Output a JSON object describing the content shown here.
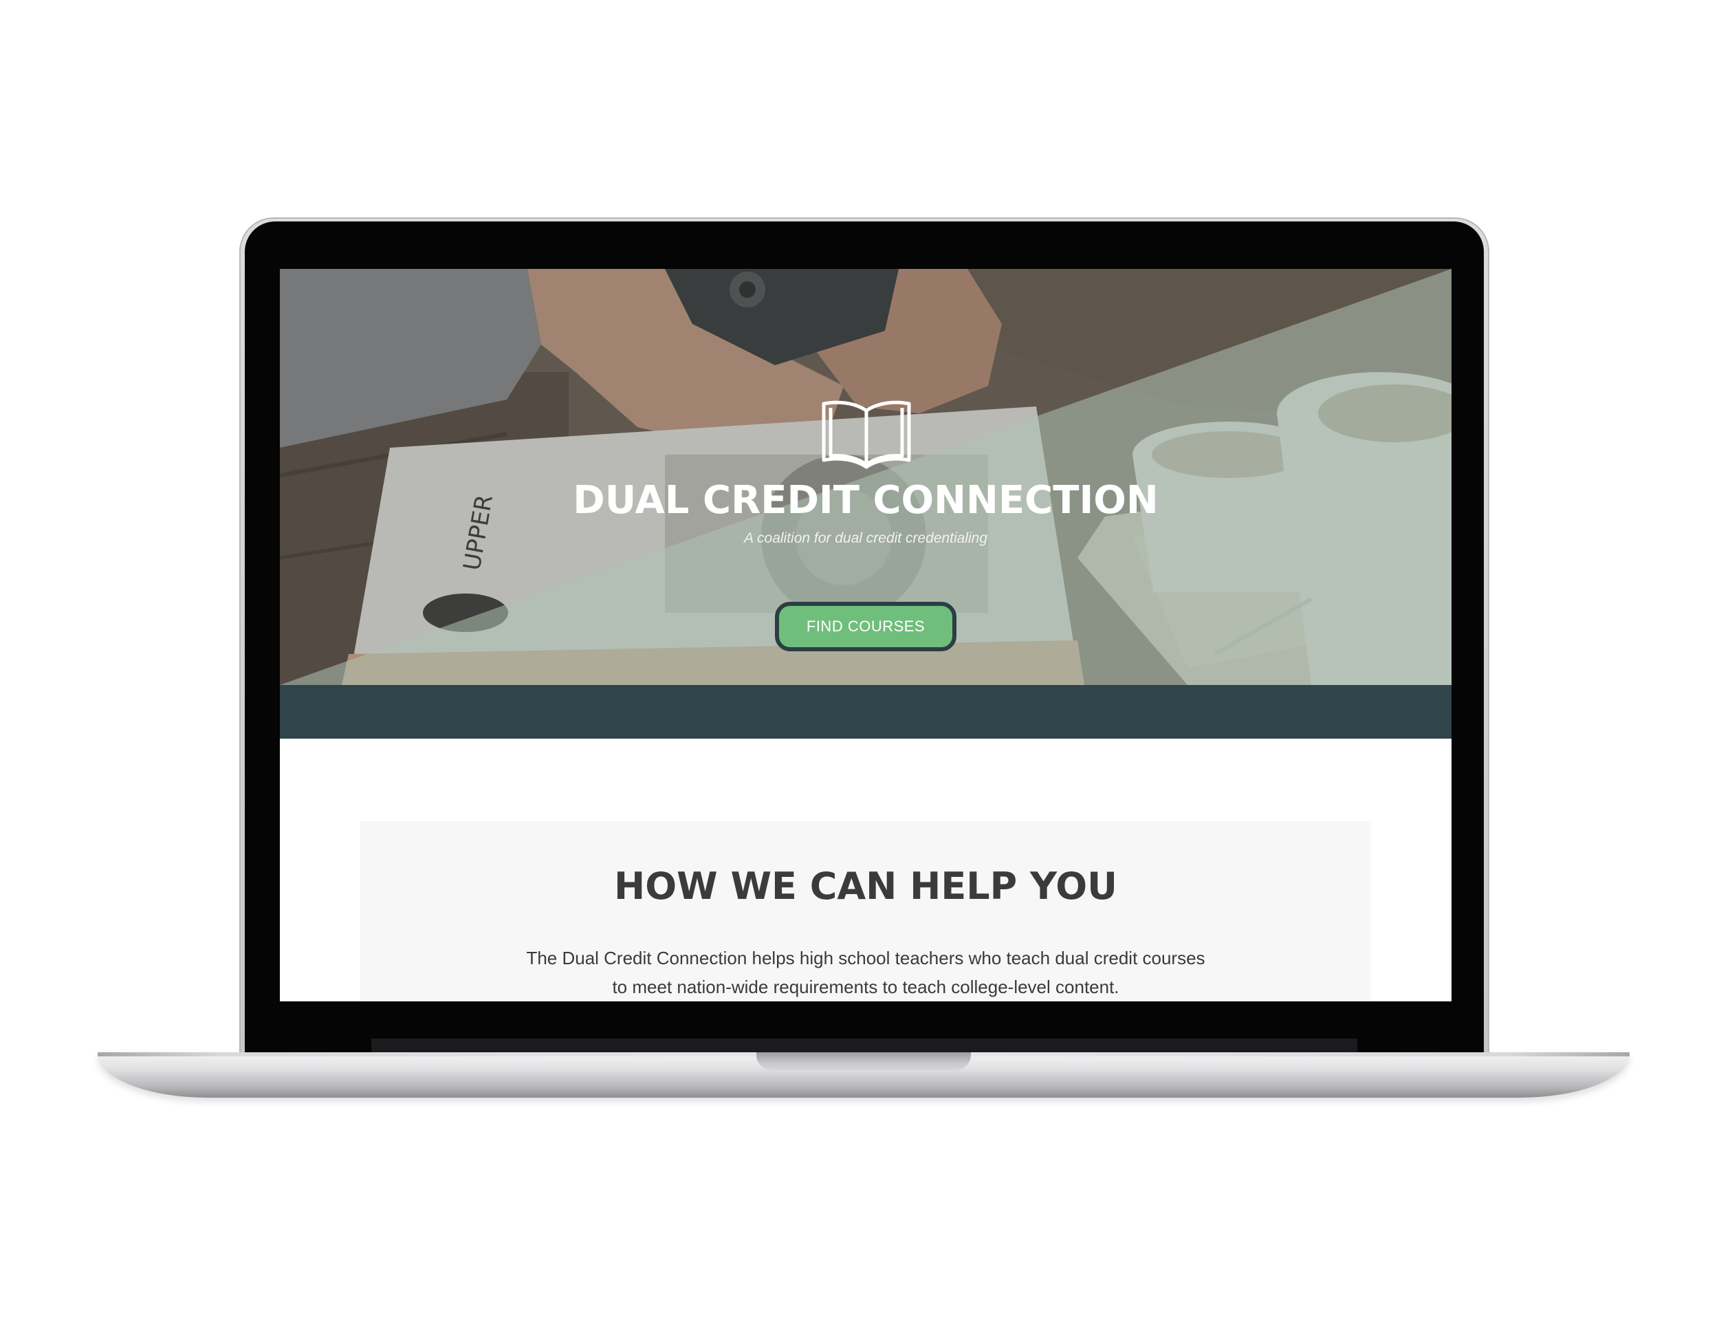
{
  "site": {
    "title": "DUAL CREDIT CONNECTION",
    "tagline": "A coalition for dual credit credentialing",
    "logo_icon": "open-book-icon"
  },
  "hero": {
    "cta_label": "FIND COURSES"
  },
  "help_section": {
    "heading": "HOW WE CAN HELP YOU",
    "body_line1": "The Dual Credit Connection helps high school teachers who teach dual credit courses",
    "body_line2": "to meet nation-wide requirements to teach college-level content."
  },
  "colors": {
    "cta_green": "#6fbe7c",
    "cta_border": "#2c3e44",
    "band_dark": "#2f444b",
    "card_bg": "#f7f7f7",
    "heading_text": "#3b3b3b"
  }
}
